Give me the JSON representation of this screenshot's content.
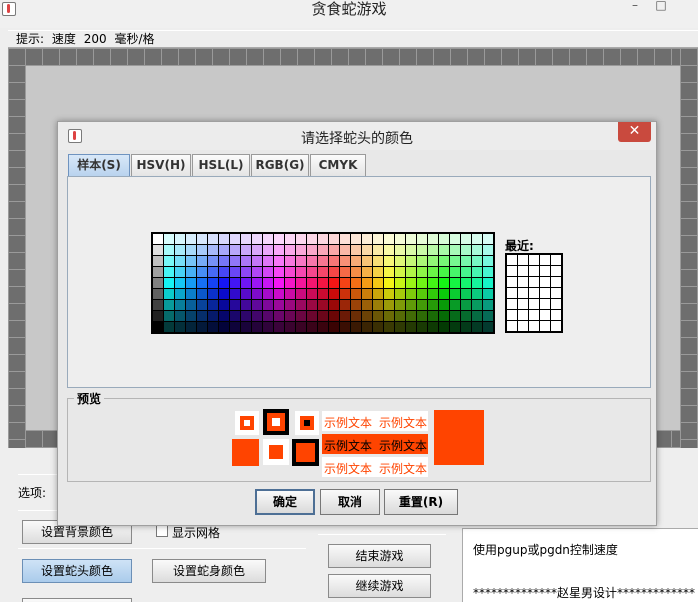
{
  "window": {
    "title": "贪食蛇游戏",
    "minimize": "–",
    "maximize": "□"
  },
  "hint": {
    "label": "提示:",
    "speed_label": "速度",
    "speed_value": "200",
    "unit": "毫秒/格"
  },
  "controls": {
    "options_label": "选项:",
    "set_background_color": "设置背景颜色",
    "show_grid": "显示网格",
    "set_head_color": "设置蛇头颜色",
    "set_body_color": "设置蛇身颜色",
    "end_game": "结束游戏",
    "continue_game": "继续游戏"
  },
  "info": {
    "speed_tip": "使用pgup或pgdn控制速度",
    "credit": "**************赵星男设计*************"
  },
  "dialog": {
    "title": "请选择蛇头的颜色",
    "close": "✕",
    "tabs": [
      "样本(S)",
      "HSV(H)",
      "HSL(L)",
      "RGB(G)",
      "CMYK"
    ],
    "active_tab": 0,
    "recent_label": "最近:",
    "preview_label": "预览",
    "sample_text": "示例文本",
    "preview_color": "#ff4400",
    "buttons": {
      "ok": "确定",
      "cancel": "取消",
      "reset": "重置(R)"
    }
  }
}
